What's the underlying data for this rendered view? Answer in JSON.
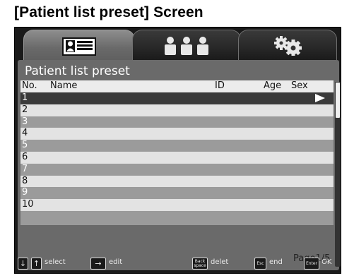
{
  "caption": "[Patient list preset] Screen",
  "tabs": [
    {
      "icon": "id-card-icon",
      "active": true
    },
    {
      "icon": "patients-group-icon",
      "active": false
    },
    {
      "icon": "settings-gears-icon",
      "active": false
    }
  ],
  "screen": {
    "title": "Patient list preset",
    "columns": {
      "no": "No.",
      "name": "Name",
      "id": "ID",
      "age": "Age",
      "sex": "Sex"
    },
    "rows": [
      "1",
      "2",
      "3",
      "4",
      "5",
      "6",
      "7",
      "8",
      "9",
      "10"
    ],
    "selected_row": "1",
    "page": "Page1/5"
  },
  "keys": {
    "down": "↓",
    "up": "↑",
    "select": "select",
    "right": "→",
    "edit": "edit",
    "backspace_line1": "Back",
    "backspace_line2": "space",
    "delete": "delet",
    "esc": "Esc",
    "end": "end",
    "enter": "Enter",
    "ok": "OK"
  }
}
